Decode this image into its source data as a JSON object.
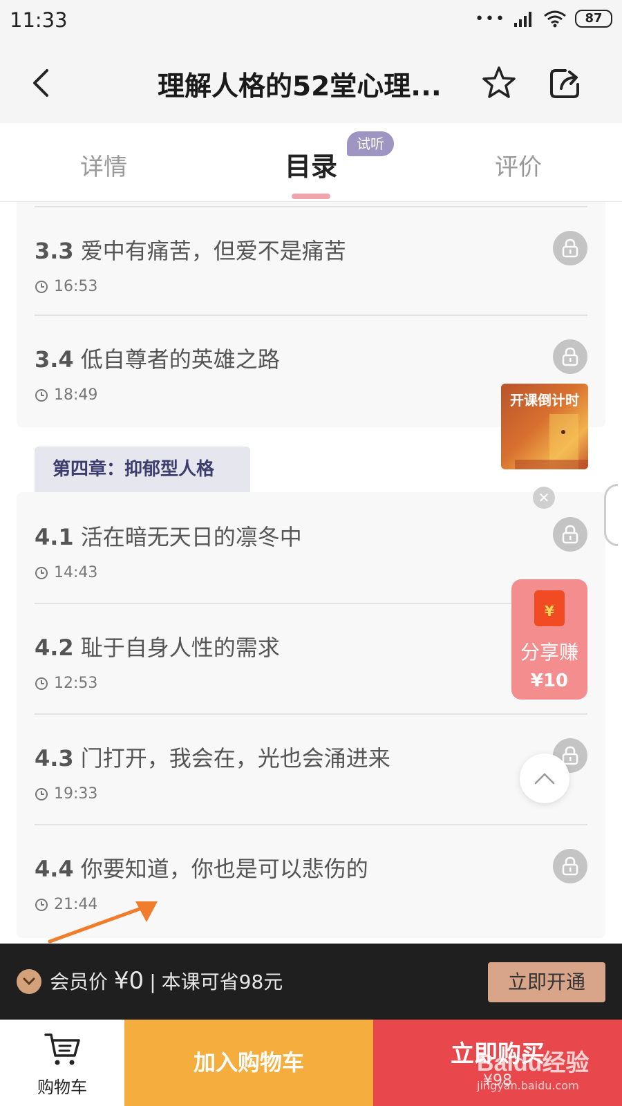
{
  "status_bar": {
    "time": "11:33",
    "battery": "87"
  },
  "header": {
    "title": "理解人格的52堂心理..."
  },
  "tabs": [
    {
      "label": "详情"
    },
    {
      "label": "目录",
      "badge": "试听",
      "active": true
    },
    {
      "label": "评价"
    }
  ],
  "lessons_top": [
    {
      "num": "3.3",
      "title": "爱中有痛苦，但爱不是痛苦",
      "duration": "16:53"
    },
    {
      "num": "3.4",
      "title": "低自尊者的英雄之路",
      "duration": "18:49"
    }
  ],
  "chapter": {
    "title": "第四章：抑郁型人格"
  },
  "lessons_bottom": [
    {
      "num": "4.1",
      "title": "活在暗无天日的凛冬中",
      "duration": "14:43"
    },
    {
      "num": "4.2",
      "title": "耻于自身人性的需求",
      "duration": "12:53"
    },
    {
      "num": "4.3",
      "title": "门打开，我会在，光也会涌进来",
      "duration": "19:33"
    },
    {
      "num": "4.4",
      "title": "你要知道，你也是可以悲伤的",
      "duration": "21:44"
    }
  ],
  "widgets": {
    "countdown_label": "开课倒计时",
    "share_earn_label": "分享赚",
    "share_earn_amount": "¥10",
    "envelope_symbol": "¥"
  },
  "member_bar": {
    "label": "会员价",
    "price": "¥0",
    "savings": "本课可省98元",
    "cta": "立即开通"
  },
  "bottom_bar": {
    "cart_label": "购物车",
    "add_to_cart": "加入购物车",
    "buy_now": "立即购买",
    "buy_price": "¥98"
  },
  "watermark": {
    "logo": "Baidu经验",
    "url": "jingyan.baidu.com"
  },
  "colors": {
    "accent_pink": "#f0a5ad",
    "trial_badge": "#9e95c2",
    "add_cart": "#f5ae3d",
    "buy_now": "#e8474b",
    "member_cta": "#d9a58a",
    "annotation_arrow": "#f07c2c"
  }
}
